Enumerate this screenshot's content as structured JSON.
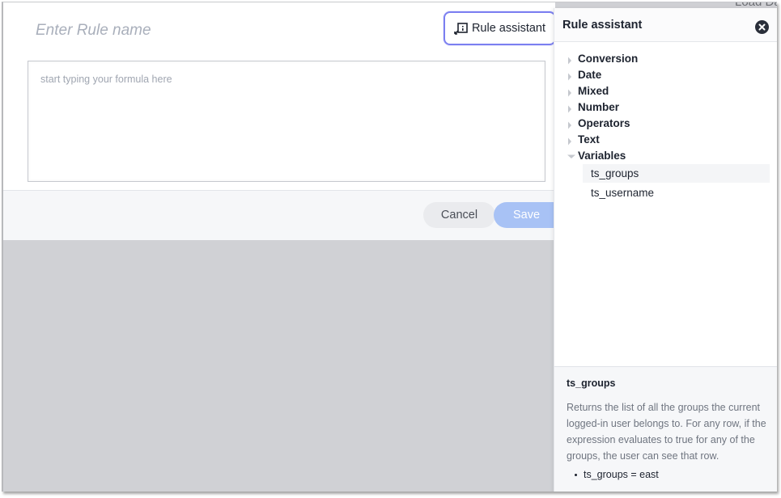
{
  "background": {
    "partial_text": "Load Da"
  },
  "modal": {
    "rule_name_placeholder": "Enter Rule name",
    "rule_name_value": "",
    "rule_assistant_button": {
      "label": "Rule assistant",
      "icon": "rule-assistant-icon",
      "state": "active"
    },
    "formula_placeholder": "start typing your formula here",
    "formula_value": "",
    "footer": {
      "cancel_label": "Cancel",
      "save_label": "Save",
      "save_disabled": true
    }
  },
  "panel": {
    "title": "Rule assistant",
    "close_icon": "close-circle-icon",
    "categories": [
      {
        "label": "Conversion",
        "expanded": false
      },
      {
        "label": "Date",
        "expanded": false
      },
      {
        "label": "Mixed",
        "expanded": false
      },
      {
        "label": "Number",
        "expanded": false
      },
      {
        "label": "Operators",
        "expanded": false
      },
      {
        "label": "Text",
        "expanded": false
      },
      {
        "label": "Variables",
        "expanded": true,
        "children": [
          {
            "label": "ts_groups",
            "selected": true
          },
          {
            "label": "ts_username",
            "selected": false
          }
        ]
      }
    ],
    "description": {
      "title": "ts_groups",
      "body": "Returns the list of all the groups the current logged-in user belongs to. For any row, if the expression evaluates to true for any of the groups, the user can see that row.",
      "examples": [
        "ts_groups = east"
      ]
    }
  },
  "colors": {
    "accent_focus": "#7b7ff0",
    "save_disabled": "#a8c2f5",
    "text_primary": "#1d232f",
    "text_muted": "#6f7580",
    "overlay": "#d0d1d5"
  }
}
